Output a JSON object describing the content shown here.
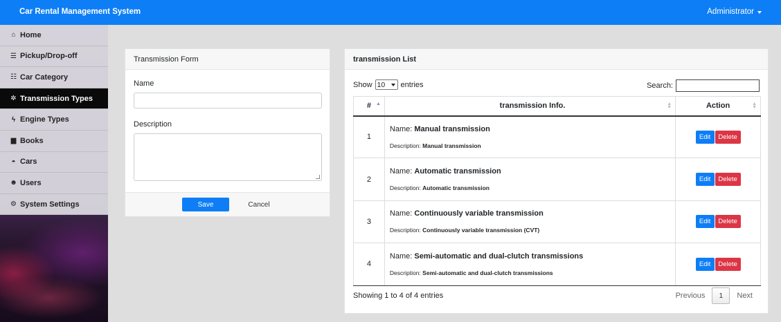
{
  "app": {
    "title": "Car Rental Management System",
    "user": "Administrator"
  },
  "sidebar": {
    "items": [
      {
        "icon": "home-icon",
        "glyph": "⌂",
        "label": "Home"
      },
      {
        "icon": "list-icon",
        "glyph": "☰",
        "label": "Pickup/Drop-off"
      },
      {
        "icon": "list-ul-icon",
        "glyph": "☷",
        "label": "Car Category"
      },
      {
        "icon": "cog-icon",
        "glyph": "✲",
        "label": "Transmission Types",
        "active": true
      },
      {
        "icon": "bolt-icon",
        "glyph": "ϟ",
        "label": "Engine Types"
      },
      {
        "icon": "book-icon",
        "glyph": "▆",
        "label": "Books"
      },
      {
        "icon": "car-icon",
        "glyph": "◓",
        "label": "Cars"
      },
      {
        "icon": "users-icon",
        "glyph": "☻",
        "label": "Users"
      },
      {
        "icon": "cogs-icon",
        "glyph": "⚙",
        "label": "System Settings"
      }
    ]
  },
  "form": {
    "title": "Transmission Form",
    "name_label": "Name",
    "name_value": "",
    "description_label": "Description",
    "description_value": "",
    "save_label": "Save",
    "cancel_label": "Cancel"
  },
  "list": {
    "title": "transmission List",
    "show_label": "Show",
    "entries_value": "10",
    "entries_label": "entries",
    "search_label": "Search:",
    "columns": [
      "#",
      "transmission Info.",
      "Action"
    ],
    "name_prefix": "Name:",
    "desc_prefix": "Description:",
    "edit_label": "Edit",
    "delete_label": "Delete",
    "rows": [
      {
        "num": "1",
        "name": "Manual transmission",
        "description": "Manual transmission"
      },
      {
        "num": "2",
        "name": "Automatic transmission",
        "description": "Automatic transmission"
      },
      {
        "num": "3",
        "name": "Continuously variable transmission",
        "description": "Continuously variable transmission (CVT)"
      },
      {
        "num": "4",
        "name": "Semi-automatic and dual-clutch transmissions",
        "description": "Semi-automatic and dual-clutch transmissions"
      }
    ],
    "info": "Showing 1 to 4 of 4 entries",
    "previous_label": "Previous",
    "current_page": "1",
    "next_label": "Next"
  }
}
